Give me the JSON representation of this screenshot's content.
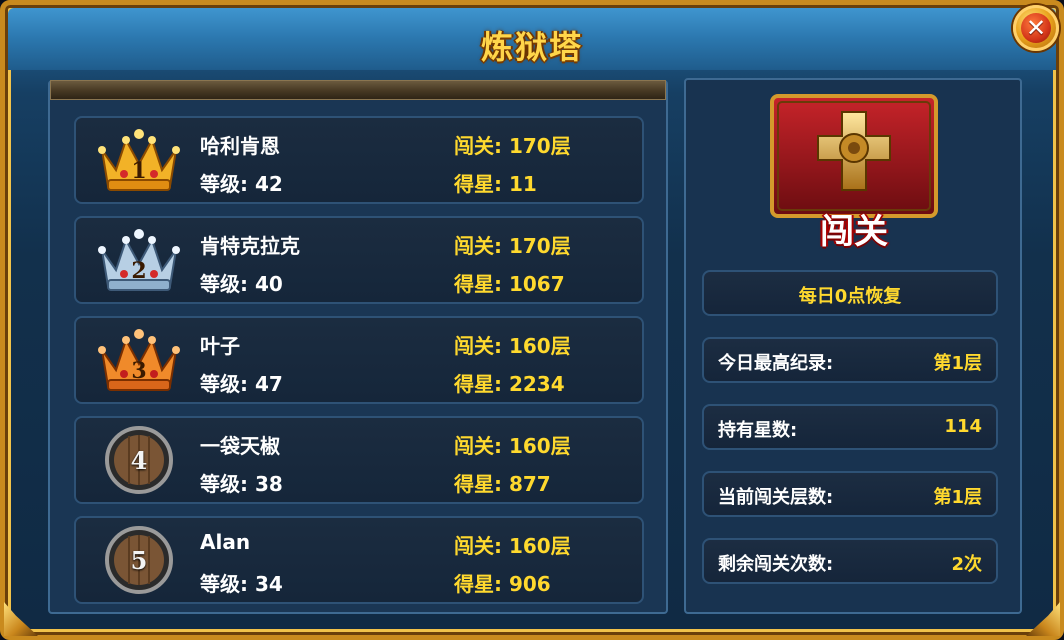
{
  "window": {
    "title": "炼狱塔"
  },
  "ranking": [
    {
      "rank": "1",
      "badge": "gold-crown",
      "name": "哈利肯恩",
      "level": "等级: 42",
      "stage": "闯关: 170层",
      "stars": "得星: 11"
    },
    {
      "rank": "2",
      "badge": "silver-crown",
      "name": "肯特克拉克",
      "level": "等级: 40",
      "stage": "闯关: 170层",
      "stars": "得星: 1067"
    },
    {
      "rank": "3",
      "badge": "bronze-crown",
      "name": "叶子",
      "level": "等级: 47",
      "stage": "闯关: 160层",
      "stars": "得星: 2234"
    },
    {
      "rank": "4",
      "badge": "wooden-shield",
      "name": "一袋天椒",
      "level": "等级: 38",
      "stage": "闯关: 160层",
      "stars": "得星: 877"
    },
    {
      "rank": "5",
      "badge": "wooden-shield",
      "name": "Alan",
      "level": "等级: 34",
      "stage": "闯关: 160层",
      "stars": "得星: 906"
    }
  ],
  "challenge": {
    "button_label": "闯关",
    "reset_note": "每日0点恢复",
    "stats": [
      {
        "label": "今日最高纪录:",
        "value": "第1层"
      },
      {
        "label": "持有星数:",
        "value": "114"
      },
      {
        "label": "当前闯关层数:",
        "value": "第1层"
      },
      {
        "label": "剩余闯关次数:",
        "value": "2次"
      }
    ]
  },
  "icons": {
    "close": "close-icon",
    "emblem": "cross-emblem-icon"
  },
  "colors": {
    "gold_text": "#ffd92e",
    "gold": "#e1a21c",
    "silver": "#a9c3da",
    "bronze": "#e8741e",
    "panel": "#183350"
  }
}
